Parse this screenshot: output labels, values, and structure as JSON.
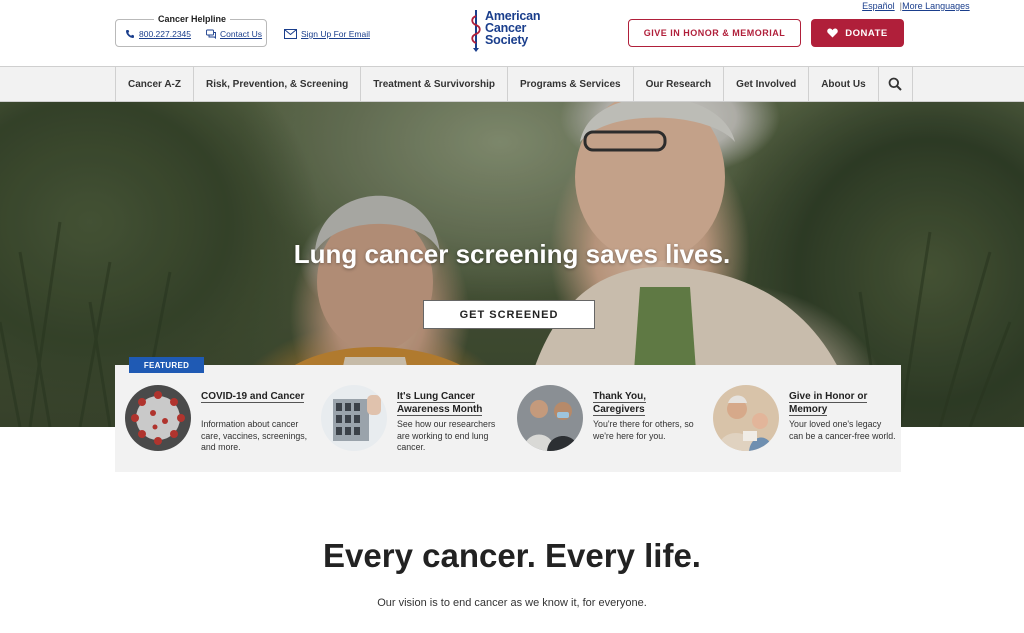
{
  "header": {
    "lang_espanol": "Español",
    "lang_more": "More Languages",
    "helpline_title": "Cancer Helpline",
    "helpline_phone": "800.227.2345",
    "contact_us": "Contact Us",
    "signup_email": "Sign Up For Email",
    "logo_line1": "American",
    "logo_line2": "Cancer",
    "logo_line3": "Society",
    "honor_button": "GIVE IN HONOR & MEMORIAL",
    "donate_button": "DONATE"
  },
  "nav": {
    "items": [
      {
        "label": "Cancer A-Z"
      },
      {
        "label": "Risk, Prevention, & Screening"
      },
      {
        "label": "Treatment & Survivorship"
      },
      {
        "label": "Programs & Services"
      },
      {
        "label": "Our Research"
      },
      {
        "label": "Get Involved"
      },
      {
        "label": "About Us"
      }
    ]
  },
  "hero": {
    "title": "Lung cancer screening saves lives.",
    "button": "GET SCREENED"
  },
  "featured": {
    "tag": "FEATURED",
    "cards": [
      {
        "title": "COVID-19 and Cancer",
        "desc": "Information about cancer care, vaccines, screenings, and more."
      },
      {
        "title": "It's Lung Cancer Awareness Month",
        "desc": "See how our researchers are working to end lung cancer."
      },
      {
        "title": "Thank You, Caregivers",
        "desc": "You're there for others, so we're here for you."
      },
      {
        "title": "Give in Honor or Memory",
        "desc": "Your loved one's legacy can be a cancer-free world."
      }
    ]
  },
  "vision": {
    "title": "Every cancer. Every life.",
    "subtitle": "Our vision is to end cancer as we know it, for everyone."
  },
  "colors": {
    "brand_blue": "#1a3e8c",
    "brand_red": "#b01f3a",
    "featured_blue": "#1f5ab4"
  }
}
